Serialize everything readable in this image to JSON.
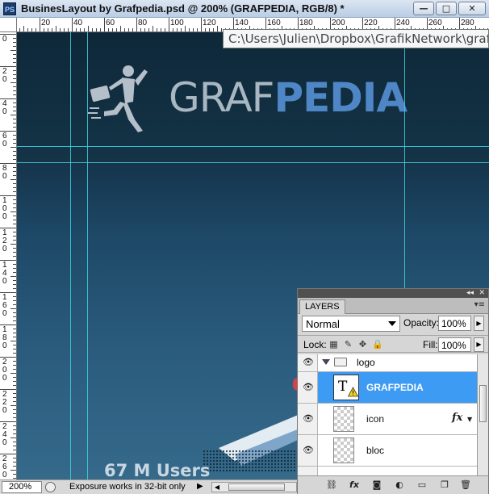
{
  "window": {
    "app_icon": "PS",
    "title": "BusinesLayout by Grafpedia.psd @ 200% (GRAFPEDIA, RGB/8) *",
    "buttons": {
      "minimize": "—",
      "maximize": "□",
      "close": "✕"
    }
  },
  "ruler_top": {
    "labels": [
      "20",
      "40",
      "60",
      "80",
      "100",
      "120",
      "140",
      "160",
      "180",
      "200",
      "220",
      "240",
      "260",
      "280"
    ]
  },
  "ruler_left": {
    "labels": [
      "0",
      "20",
      "40",
      "60",
      "80",
      "100",
      "120",
      "140",
      "160",
      "180",
      "200",
      "220",
      "240",
      "260"
    ]
  },
  "canvas": {
    "logo_text_part1": "GRAF",
    "logo_text_part2": "PEDIA",
    "users_text": "67 M Users",
    "path_tooltip": "C:\\Users\\Julien\\Dropbox\\GrafikNetwork\\grafpedia"
  },
  "statusbar": {
    "zoom": "200%",
    "info": "Exposure works in 32-bit only",
    "arrow": "▶"
  },
  "layers_panel": {
    "tab_label": "LAYERS",
    "menu_icon": "▾≡",
    "collapse_icon": "◂◂",
    "close_icon": "✕",
    "blend_mode": "Normal",
    "opacity_label": "Opacity:",
    "opacity_value": "100%",
    "lock_label": "Lock:",
    "fill_label": "Fill:",
    "fill_value": "100%",
    "layers": [
      {
        "name": "logo",
        "type": "group"
      },
      {
        "name": "GRAFPEDIA",
        "type": "text",
        "selected": true
      },
      {
        "name": "icon",
        "type": "pixel",
        "fx": "fx"
      },
      {
        "name": "bloc",
        "type": "pixel"
      }
    ],
    "bottom_icons": [
      "link-icon",
      "fx-icon",
      "mask-icon",
      "adjustment-icon",
      "folder-icon",
      "new-layer-icon",
      "trash-icon"
    ]
  },
  "colors": {
    "guide": "#3fd5e0",
    "selected_layer": "#3d9bf3",
    "logo_accent": "#4f86c6"
  }
}
